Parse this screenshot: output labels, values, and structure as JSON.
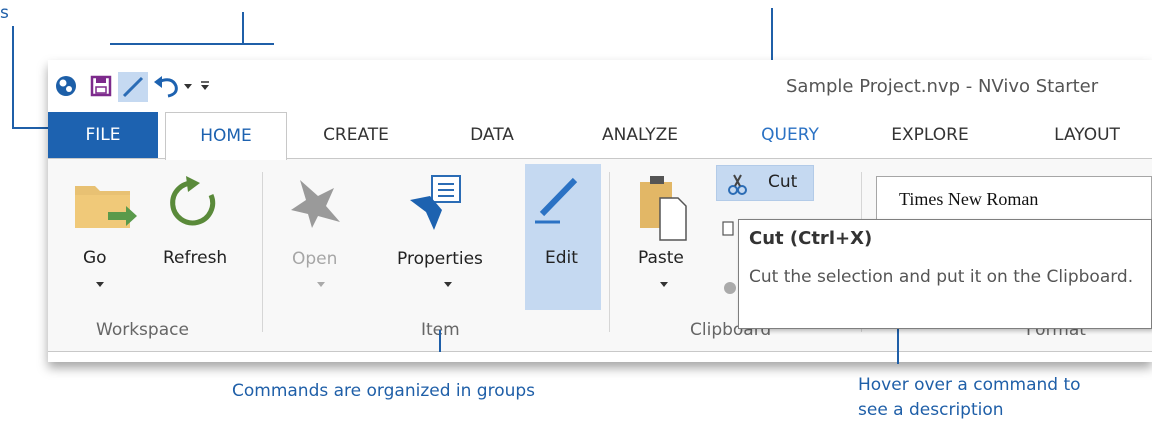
{
  "window": {
    "title": "Sample Project.nvp - NVivo Starter"
  },
  "tabs": [
    {
      "label": "FILE"
    },
    {
      "label": "HOME"
    },
    {
      "label": "CREATE"
    },
    {
      "label": "DATA"
    },
    {
      "label": "ANALYZE"
    },
    {
      "label": "QUERY"
    },
    {
      "label": "EXPLORE"
    },
    {
      "label": "LAYOUT"
    }
  ],
  "groups": {
    "workspace": {
      "label": "Workspace",
      "go": "Go",
      "refresh": "Refresh"
    },
    "item": {
      "label": "Item",
      "open": "Open",
      "properties": "Properties",
      "edit": "Edit"
    },
    "clipboard": {
      "label": "Clipboard",
      "paste": "Paste",
      "cut": "Cut"
    },
    "format": {
      "label": "Format",
      "font": "Times New Roman"
    }
  },
  "tooltip": {
    "title": "Cut (Ctrl+X)",
    "description": "Cut the selection and put it on the Clipboard."
  },
  "annotations": {
    "left_partial": "s",
    "groups_note": "Commands are organized in groups",
    "hover_note_line1": "Hover over a command to",
    "hover_note_line2": "see a description"
  },
  "colors": {
    "accent": "#1d62b0",
    "annotation": "#1f5fa8",
    "highlight": "#c5d9f1"
  }
}
